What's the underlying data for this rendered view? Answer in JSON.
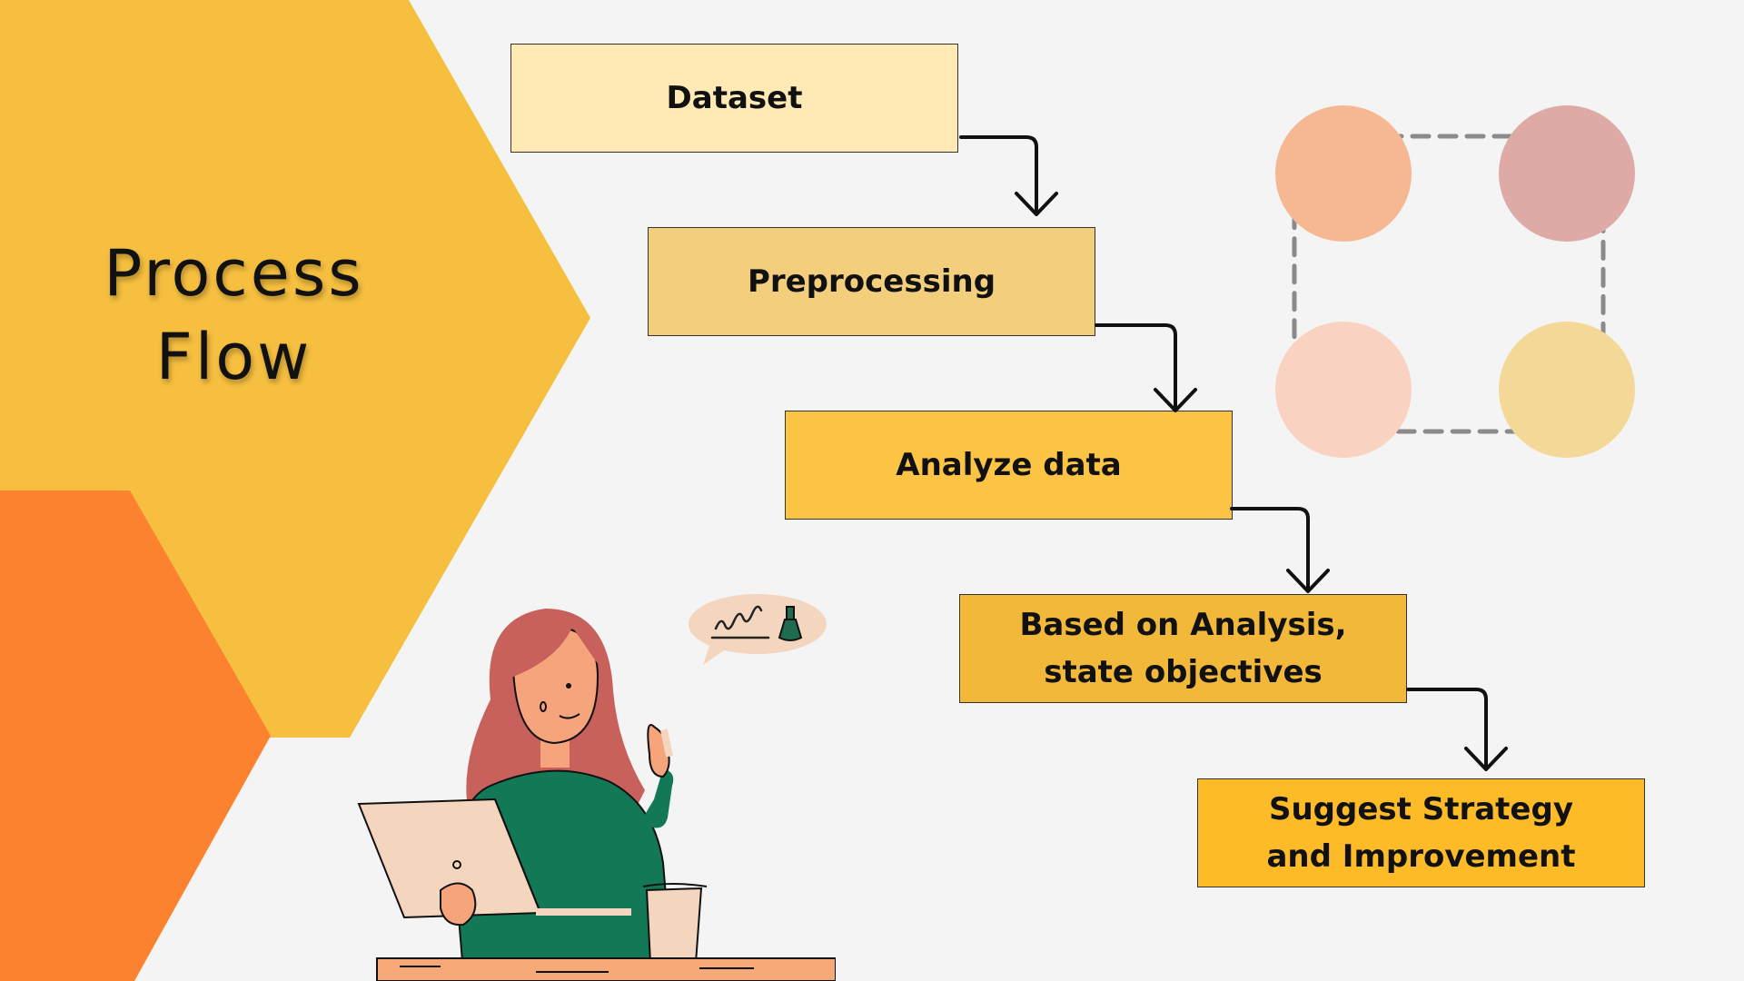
{
  "title": {
    "line1": "Process",
    "line2": "Flow"
  },
  "steps": [
    {
      "lines": [
        "Dataset"
      ]
    },
    {
      "lines": [
        "Preprocessing"
      ]
    },
    {
      "lines": [
        "Analyze data"
      ]
    },
    {
      "lines": [
        "Based on Analysis,",
        "state objectives"
      ]
    },
    {
      "lines": [
        "Suggest Strategy",
        "and Improvement"
      ]
    }
  ],
  "colors": {
    "background": "#f4f4f4",
    "hexagon_yellow": "#f6bf3f",
    "hexagon_orange": "#fd8230",
    "step_fills": [
      "#ffe9b4",
      "#f3cf7d",
      "#fbc445",
      "#f2b83a",
      "#fcbb27"
    ],
    "circle_fills": [
      "#f5b892",
      "#ddaaa6",
      "#f9d2c1",
      "#f3d897"
    ],
    "dashed_ring": "#8a8a8a",
    "arrow": "#111111"
  },
  "icons": [
    "wavy-scribble-icon",
    "flask-icon"
  ]
}
